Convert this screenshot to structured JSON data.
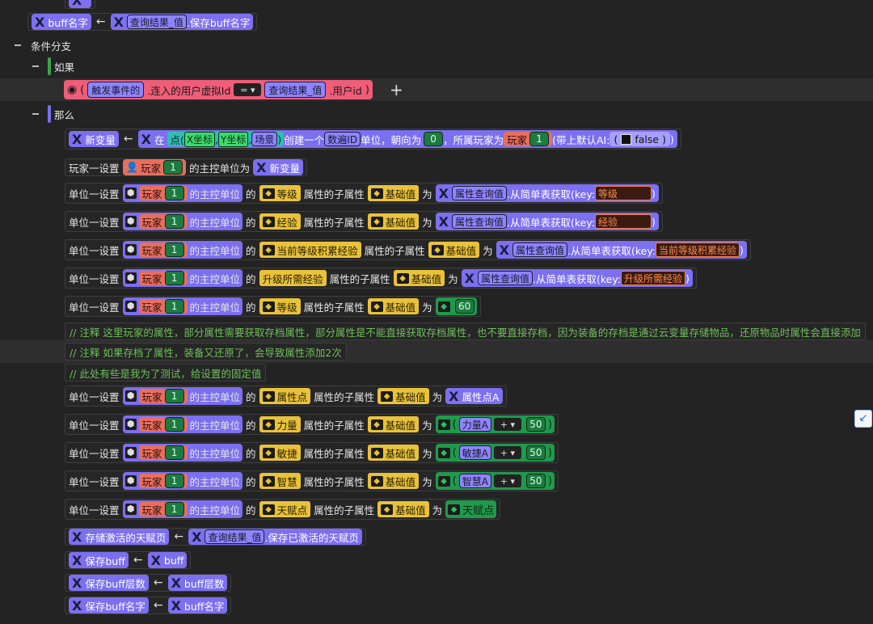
{
  "rows": {
    "buff_save_top": {
      "var": "buff名字",
      "src": "查询结果_值",
      "method": ".保存buff名字"
    },
    "branch_label": "条件分支",
    "if_label": "如果",
    "cond": {
      "left_obj": "触发事件的",
      "left_prop": ".连入的用户虚拟Id",
      "op": "=",
      "right_obj": "查询结果_值",
      "right_prop": ".用户id"
    },
    "add_btn": "+",
    "then_label": "那么",
    "newvar": {
      "var": "新变量",
      "in": "在",
      "pt": "点(",
      "x": "X坐标",
      "y": "Y坐标",
      "scene": "场景",
      "create": "创建一个",
      "num_id": "数遍ID",
      "unit_word": "单位，朝向为",
      "angle": "0",
      "owner": "，所属玩家为",
      "player": "玩家",
      "player_n": "1",
      "ai": "(带上默认AI:",
      "bool_v": "false"
    },
    "set_main": {
      "prefix": "玩家一设置",
      "player": "玩家",
      "n": "1",
      "mid": "的主控单位为",
      "var": "新变量"
    },
    "unit_set_prefix": "单位一设置",
    "main_unit": "的主控单位",
    "of": "的",
    "sub_attr_text": "属性的子属性",
    "base_value": "基础值",
    "as": "为",
    "attr_query": "属性查询值",
    "table_get": ".从简单表获取(key:",
    "attrs": {
      "level": "等级",
      "exp": "经验",
      "cur_exp": "当前等级积累经验",
      "need_exp": "升级所需经验",
      "level2": "等级",
      "points": "属性点",
      "str": "力量",
      "agi": "敏捷",
      "int": "智慧",
      "talent": "天赋点"
    },
    "val_60": "60",
    "points_var": "属性点A",
    "str_var": "力量A",
    "agi_var": "敏捷A",
    "int_var": "智慧A",
    "plus_op": "+",
    "v50": "50",
    "talent_val": "天赋点",
    "comment1": "// 注释 这里玩家的属性，部分属性需要获取存档属性，部分属性是不能直接获取存档属性，也不要直接存档，因为装备的存档是通过云变量存储物品，还原物品时属性会直接添加",
    "comment2": "// 注释 如果存档了属性，装备又还原了，会导致属性添加2次",
    "comment3": "// 此处有些是我为了测试，给设置的固定值",
    "store_talent": {
      "var": "存储激活的天赋页",
      "src": "查询结果_值",
      "method": ".保存已激活的天赋页"
    },
    "save_buff": {
      "var": "保存buff",
      "src": "buff"
    },
    "save_buff_layers": {
      "var": "保存buff层数",
      "src": "buff层数"
    },
    "save_buff_name": {
      "var": "保存buff名字",
      "src": "buff名字"
    },
    "player_word": "玩家",
    "player_n": "1",
    "arrow": "←"
  }
}
